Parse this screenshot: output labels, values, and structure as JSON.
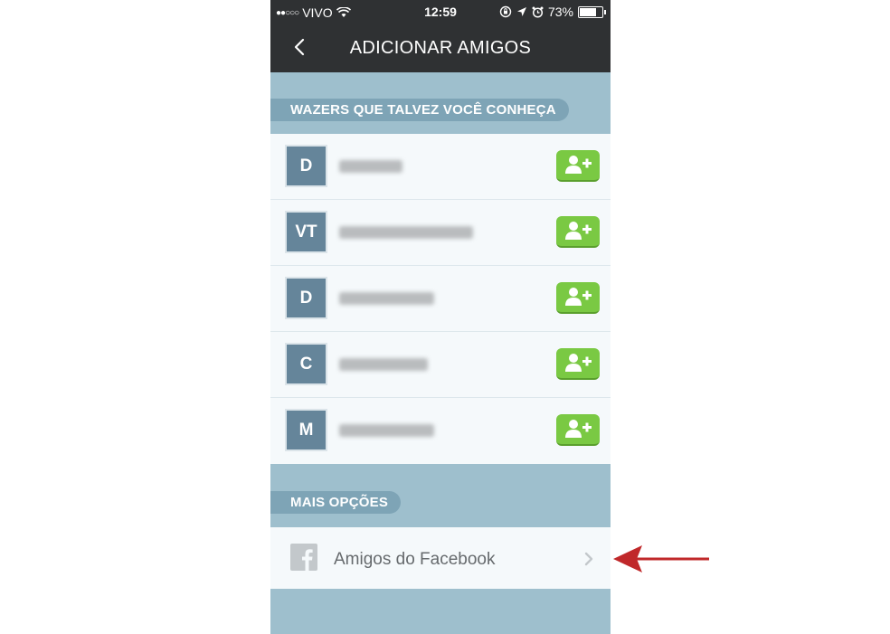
{
  "status_bar": {
    "signal_dots": "●●○○○",
    "carrier": "VIVO",
    "time": "12:59",
    "battery_percent": "73%",
    "battery_level": 0.73
  },
  "nav": {
    "title": "ADICIONAR AMIGOS"
  },
  "sections": {
    "suggestions_title": "WAZERS QUE TALVEZ VOCÊ CONHEÇA",
    "more_options_title": "MAIS OPÇÕES"
  },
  "suggestions": [
    {
      "initials": "D"
    },
    {
      "initials": "VT"
    },
    {
      "initials": "D"
    },
    {
      "initials": "C"
    },
    {
      "initials": "M"
    }
  ],
  "more_options": {
    "facebook_label": "Amigos do Facebook"
  },
  "colors": {
    "header_bg": "#2f3133",
    "section_bg": "#9ebfcd",
    "pill_bg": "#7ea4b6",
    "avatar_bg": "#65859a",
    "add_button": "#7ac943",
    "annotation_arrow": "#c0282a"
  }
}
